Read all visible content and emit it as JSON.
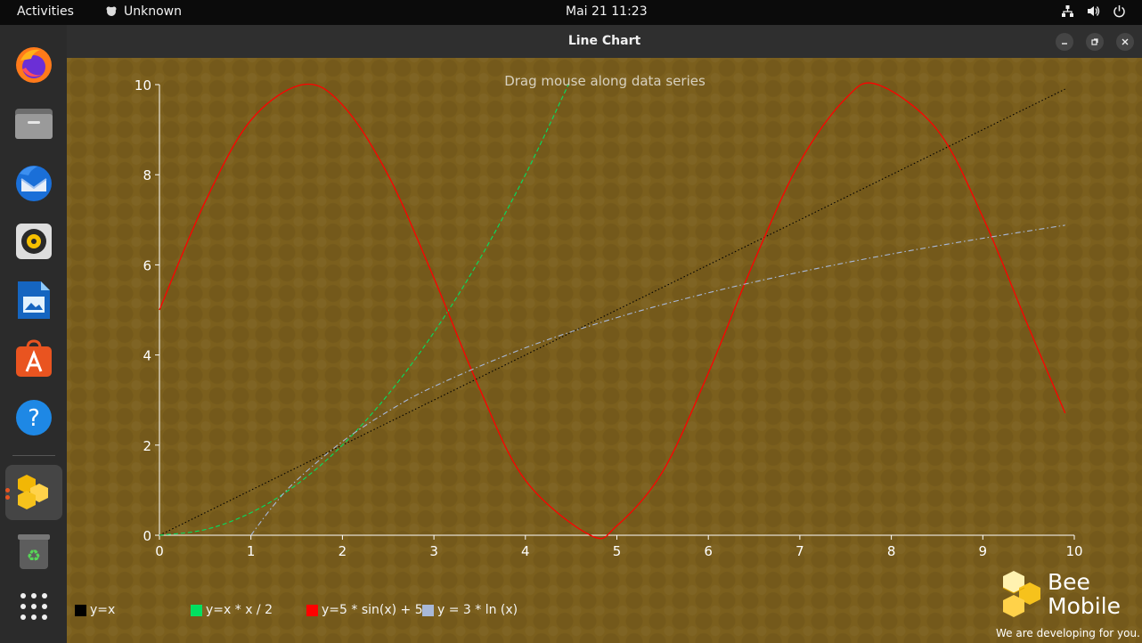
{
  "topbar": {
    "activities": "Activities",
    "app_name": "Unknown",
    "clock": "Mai 21  11:23"
  },
  "dock": {
    "items": [
      "firefox-icon",
      "files-icon",
      "thunderbird-icon",
      "rhythmbox-icon",
      "writer-icon",
      "software-icon",
      "help-icon",
      "beemobile-icon",
      "trash-icon",
      "app-grid-icon"
    ]
  },
  "window": {
    "title": "Line Chart"
  },
  "branding": {
    "name_line1": "Bee",
    "name_line2": "Mobile",
    "tagline": "We are developing for you."
  },
  "colors": {
    "chart_background": "#7b5f1d",
    "axis": "#ffffff",
    "series_black": "#000000",
    "series_green": "#00e060",
    "series_red": "#ff0000",
    "series_lightblue": "#a8b8d8"
  },
  "chart_data": {
    "type": "line",
    "title": "",
    "annotation": "Drag mouse along data series",
    "xlabel": "",
    "ylabel": "",
    "xlim": [
      0,
      10
    ],
    "ylim": [
      0,
      10
    ],
    "xticks": [
      0,
      1,
      2,
      3,
      4,
      5,
      6,
      7,
      8,
      9,
      10
    ],
    "yticks": [
      0,
      2,
      4,
      6,
      8,
      10
    ],
    "grid": false,
    "legend_position": "bottom-left",
    "series": [
      {
        "name": "y=x",
        "color": "#000000",
        "style": "dotted",
        "x": [
          0,
          9.9
        ],
        "y": [
          0,
          9.9
        ]
      },
      {
        "name": "y=x * x / 2",
        "color": "#00e060",
        "style": "dashed",
        "x": [
          0,
          0.5,
          1,
          1.5,
          2,
          2.5,
          3,
          3.5,
          4,
          4.47
        ],
        "y": [
          0,
          0.125,
          0.5,
          1.125,
          2,
          3.125,
          4.5,
          6.125,
          8,
          10
        ]
      },
      {
        "name": "y=5 * sin(x) + 5",
        "color": "#ff0000",
        "style": "solid",
        "x": [
          0,
          0.5,
          1,
          1.57,
          2,
          2.5,
          3,
          3.5,
          4,
          4.71,
          5,
          5.5,
          6,
          6.5,
          7,
          7.5,
          7.85,
          8.5,
          9,
          9.5,
          9.9
        ],
        "y": [
          5,
          7.4,
          9.21,
          10,
          9.55,
          7.99,
          5.71,
          3.25,
          1.22,
          0,
          0.21,
          1.41,
          3.6,
          6.08,
          8.28,
          9.69,
          10,
          9.0,
          7.06,
          4.62,
          2.71
        ]
      },
      {
        "name": "y = 3 * ln (x)",
        "color": "#a8b8d8",
        "style": "dashdot",
        "x": [
          1,
          1.25,
          1.5,
          2,
          2.5,
          3,
          4,
          5,
          6,
          7,
          8,
          9,
          9.9
        ],
        "y": [
          0,
          0.67,
          1.22,
          2.08,
          2.75,
          3.3,
          4.16,
          4.83,
          5.38,
          5.84,
          6.24,
          6.59,
          6.88
        ]
      }
    ]
  }
}
